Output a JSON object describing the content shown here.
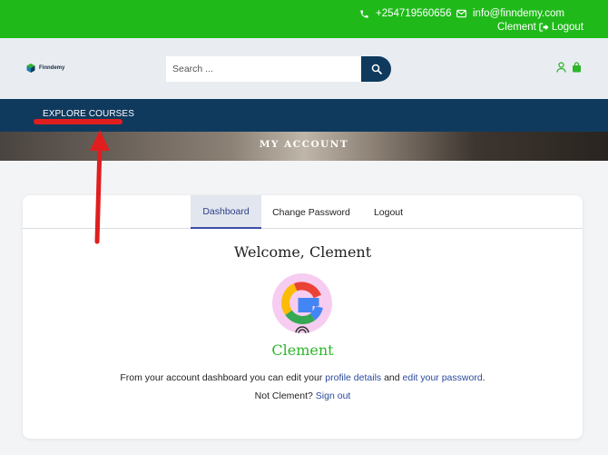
{
  "topbar": {
    "phone": "+254719560656",
    "email": "info@finndemy.com",
    "user": "Clement",
    "logout": "Logout"
  },
  "header": {
    "logo_text": "Finndemy",
    "search_placeholder": "Search ..."
  },
  "nav": {
    "explore": "EXPLORE COURSES"
  },
  "banner": {
    "title": "MY ACCOUNT"
  },
  "account": {
    "tabs": [
      "Dashboard",
      "Change Password",
      "Logout"
    ],
    "welcome": "Welcome, Clement",
    "name": "Clement",
    "line1_pre": "From your account dashboard you can edit your",
    "profile_link": "profile details",
    "line1_and": "and",
    "password_link": "edit your password",
    "line1_end": ".",
    "line2_pre": "Not Clement?",
    "signout_link": "Sign out"
  },
  "colors": {
    "topbar_green": "#1fba1a",
    "navy": "#0f3a5e",
    "link_blue": "#2c4a9c",
    "name_green": "#2fb52a",
    "annotation_red": "#e01e1e"
  }
}
